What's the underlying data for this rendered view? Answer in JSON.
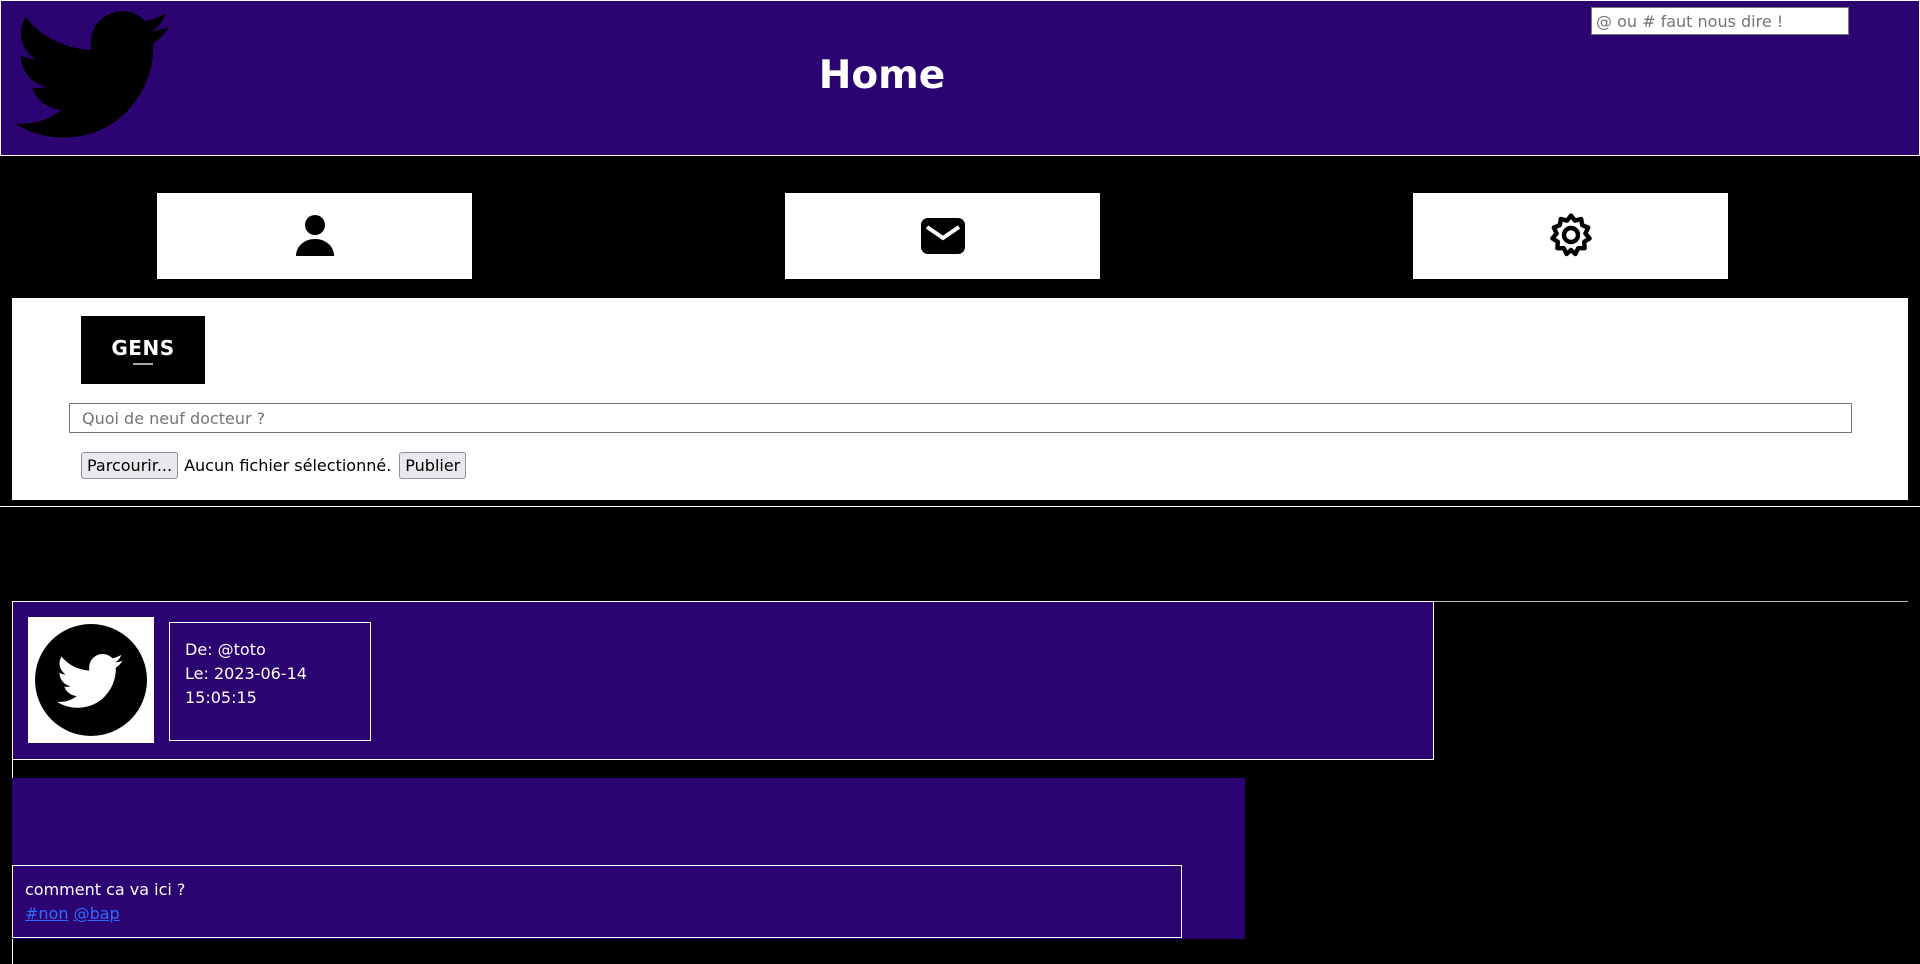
{
  "header": {
    "title": "Home",
    "search_placeholder": "@ ou # faut nous dire !"
  },
  "nav": [
    {
      "icon": "person-icon"
    },
    {
      "icon": "envelope-icon"
    },
    {
      "icon": "gear-icon"
    }
  ],
  "compose": {
    "logo_text": "GENS",
    "placeholder": "Quoi de neuf docteur ?",
    "browse_label": "Parcourir...",
    "no_file_text": "Aucun fichier sélectionné.",
    "publish_label": "Publier"
  },
  "post": {
    "author": "De: @toto",
    "date": "Le: 2023-06-14 15:05:15",
    "text": "comment ca va ici ?",
    "tags": [
      "#non",
      "@bap"
    ]
  },
  "colors": {
    "header_bg": "#2b0472",
    "page_bg": "#000000",
    "link": "#2d6cff"
  }
}
